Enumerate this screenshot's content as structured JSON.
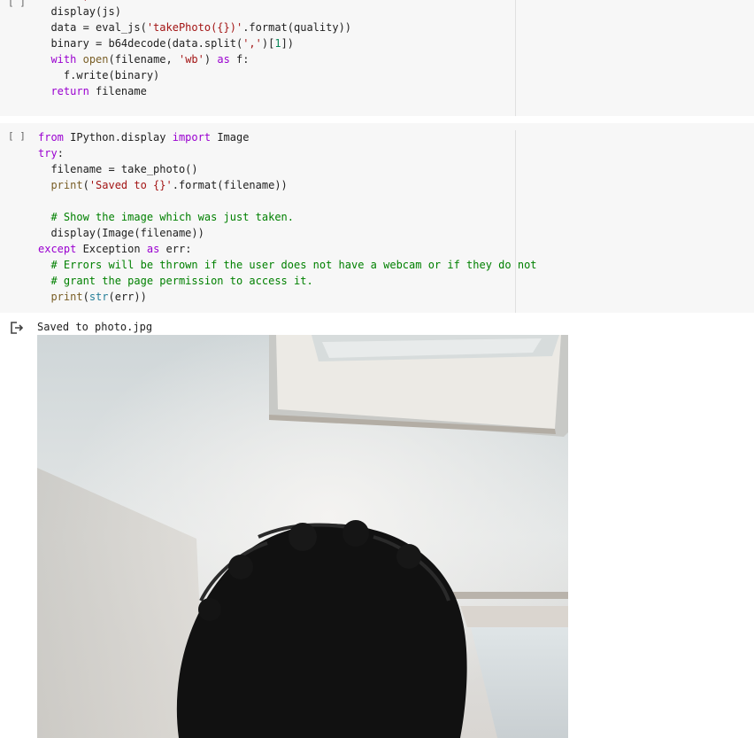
{
  "cells": [
    {
      "run_label": "[ ]",
      "lines": [
        [
          [
            "    ",
            ""
          ],
          [
            "''')",
            "t-str"
          ]
        ],
        [
          [
            "  display(js)",
            ""
          ]
        ],
        [
          [
            "  data = eval_js(",
            ""
          ],
          [
            "'takePhoto({})'",
            "t-str"
          ],
          [
            ".format(quality))",
            ""
          ]
        ],
        [
          [
            "  binary = b64decode(data.split(",
            ""
          ],
          [
            "','",
            "t-str"
          ],
          [
            ")[",
            ""
          ],
          [
            "1",
            "t-num"
          ],
          [
            "])",
            ""
          ]
        ],
        [
          [
            "  ",
            ""
          ],
          [
            "with",
            "t-kw"
          ],
          [
            " ",
            ""
          ],
          [
            "open",
            "t-bi"
          ],
          [
            "(filename, ",
            ""
          ],
          [
            "'wb'",
            "t-str"
          ],
          [
            ") ",
            ""
          ],
          [
            "as",
            "t-kw"
          ],
          [
            " f:",
            ""
          ]
        ],
        [
          [
            "    f.write(binary)",
            ""
          ]
        ],
        [
          [
            "  ",
            ""
          ],
          [
            "return",
            "t-kw"
          ],
          [
            " filename",
            ""
          ]
        ]
      ]
    },
    {
      "run_label": "[ ]",
      "lines": [
        [
          [
            "from",
            "t-kw"
          ],
          [
            " IPython.display ",
            ""
          ],
          [
            "import",
            "t-kw"
          ],
          [
            " Image",
            ""
          ]
        ],
        [
          [
            "try",
            "t-kw"
          ],
          [
            ":",
            ""
          ]
        ],
        [
          [
            "  filename = take_photo()",
            ""
          ]
        ],
        [
          [
            "  ",
            ""
          ],
          [
            "print",
            "t-bi"
          ],
          [
            "(",
            ""
          ],
          [
            "'Saved to {}'",
            "t-str"
          ],
          [
            ".format(filename))",
            ""
          ]
        ],
        [
          [
            "",
            ""
          ]
        ],
        [
          [
            "  ",
            ""
          ],
          [
            "# Show the image which was just taken.",
            "t-com"
          ]
        ],
        [
          [
            "  display(Image(filename))",
            ""
          ]
        ],
        [
          [
            "except",
            "t-kw"
          ],
          [
            " Exception ",
            ""
          ],
          [
            "as",
            "t-kw"
          ],
          [
            " err:",
            ""
          ]
        ],
        [
          [
            "  ",
            ""
          ],
          [
            "# Errors will be thrown if the user does not have a webcam or if they do not",
            "t-com"
          ]
        ],
        [
          [
            "  ",
            ""
          ],
          [
            "# grant the page permission to access it.",
            "t-com"
          ]
        ],
        [
          [
            "  ",
            ""
          ],
          [
            "print",
            "t-bi"
          ],
          [
            "(",
            ""
          ],
          [
            "str",
            "t-type"
          ],
          [
            "(err))",
            ""
          ]
        ]
      ]
    }
  ],
  "output": {
    "icon": "output-arrow-icon",
    "text": "Saved to photo.jpg",
    "image": "webcam-photo"
  },
  "colors": {
    "cell_bg": "#f7f7f7",
    "keyword": "#9a00d0",
    "string": "#a31515",
    "comment": "#008000",
    "number": "#098658"
  }
}
